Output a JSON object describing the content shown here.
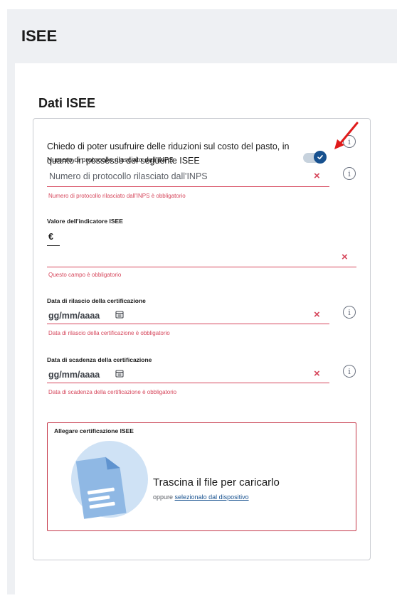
{
  "page": {
    "title": "ISEE"
  },
  "section": {
    "title": "Dati ISEE"
  },
  "toggle": {
    "text": "Chiedo di poter usufruire delle riduzioni sul costo del pasto, in quanto in possesso del seguente ISEE",
    "overlap_label": "Numero di protocollo rilasciato dall'INPS",
    "state": "on"
  },
  "protocol": {
    "placeholder": "Numero di protocollo rilasciato dall'INPS",
    "error": "Numero di protocollo rilasciato dall'INPS è obbligatorio"
  },
  "isee_value": {
    "label": "Valore dell'indicatore ISEE",
    "currency": "€",
    "error": "Questo campo è obbligatorio"
  },
  "release_date": {
    "label": "Data di rilascio della certificazione",
    "placeholder": "gg/mm/aaaa",
    "error": "Data di rilascio della certificazione è obbligatorio"
  },
  "expiry_date": {
    "label": "Data di scadenza della certificazione",
    "placeholder": "gg/mm/aaaa",
    "error": "Data di scadenza della certificazione è obbligatorio"
  },
  "upload": {
    "label": "Allegare certificazione ISEE",
    "title": "Trascina il file per caricarlo",
    "sub_prefix": "oppure",
    "sub_link": "selezionalo dal dispositivo"
  },
  "icons": {
    "info": "info-icon",
    "clear": "clear-icon",
    "calendar": "calendar-icon",
    "check": "check-icon",
    "file": "file-icon",
    "arrow": "red-arrow-icon"
  },
  "colors": {
    "error": "#d6475c",
    "accent": "#17518f",
    "upload_border": "#c53648",
    "upload_circle": "#cfe2f5"
  }
}
